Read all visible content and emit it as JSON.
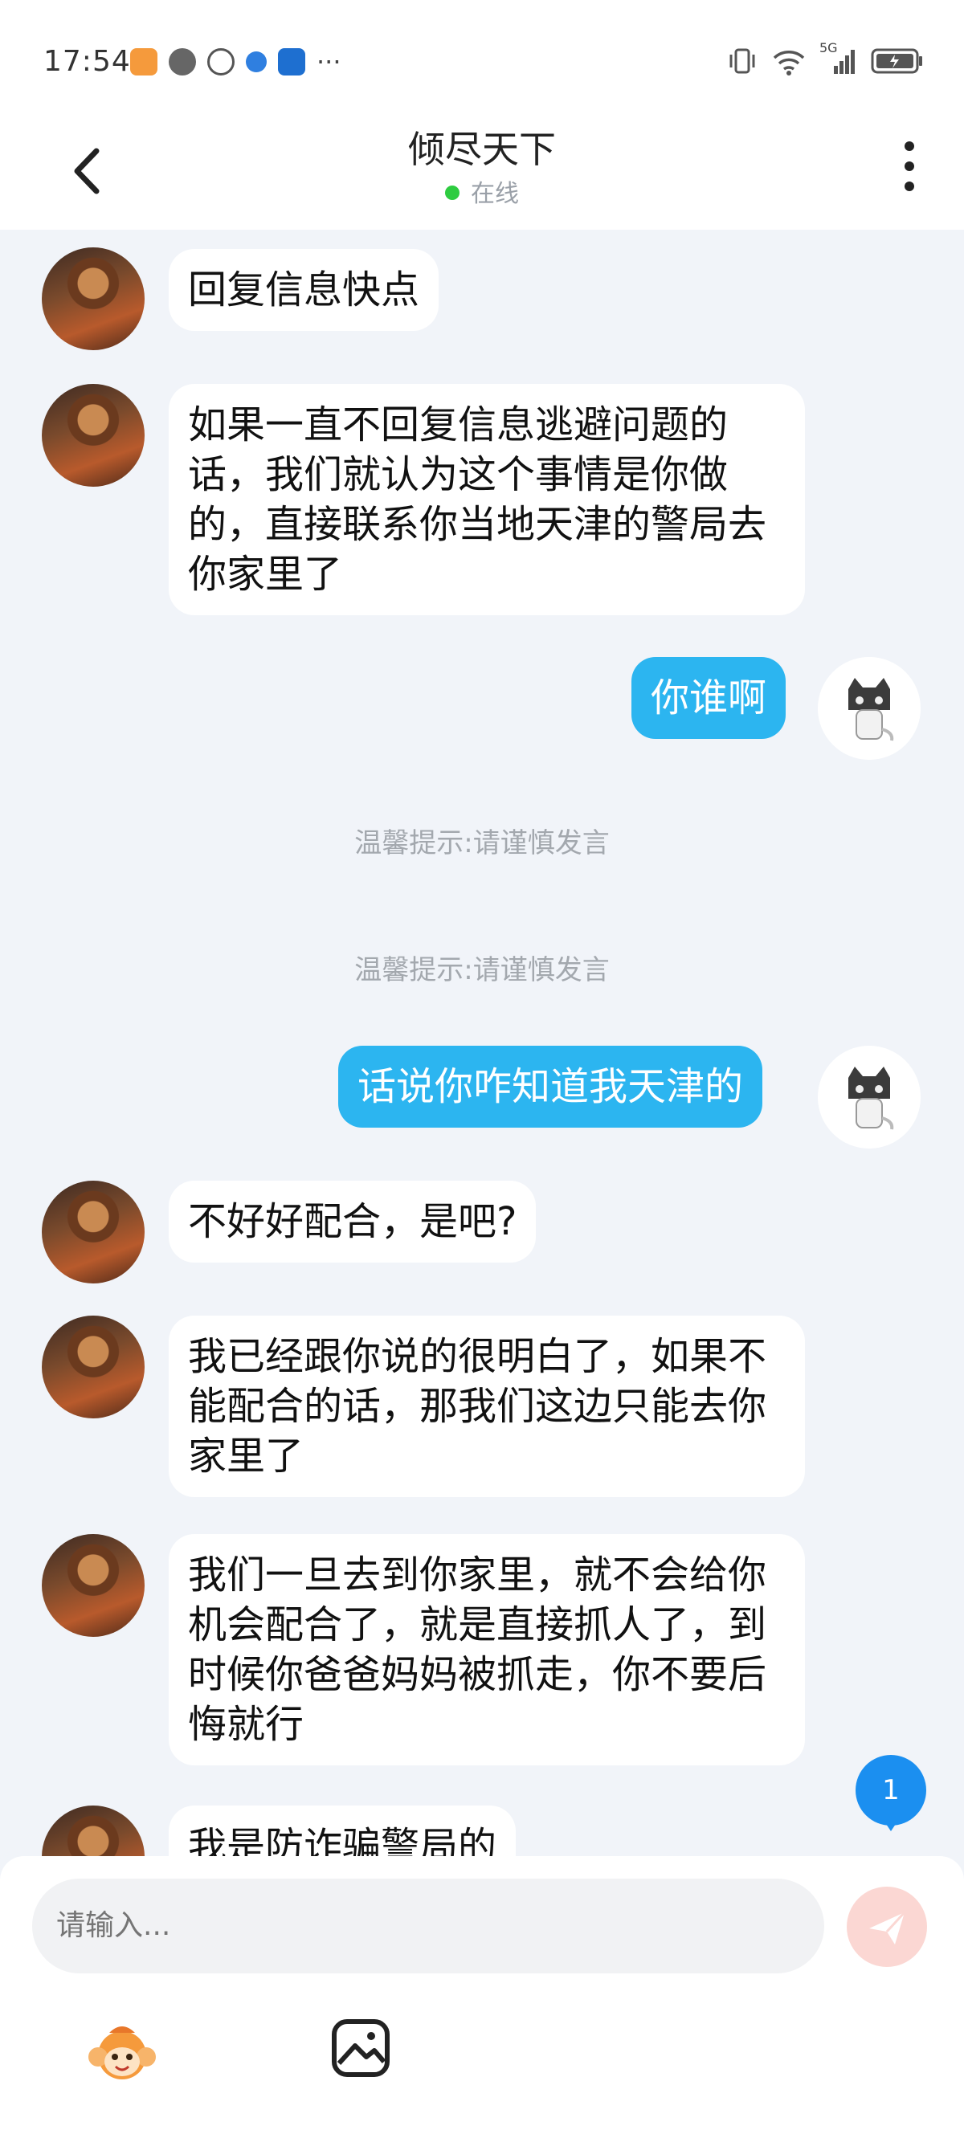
{
  "status_bar": {
    "time": "17:54",
    "more": "···",
    "network": "5G"
  },
  "header": {
    "title": "倾尽天下",
    "status": "在线"
  },
  "messages": [
    {
      "from": "other",
      "text": "回复信息快点"
    },
    {
      "from": "other",
      "text": "如果一直不回复信息逃避问题的话，我们就认为这个事情是你做的，直接联系你当地天津的警局去你家里了"
    },
    {
      "from": "self",
      "text": "你谁啊"
    },
    {
      "from": "system",
      "text": "温馨提示:请谨慎发言"
    },
    {
      "from": "system",
      "text": "温馨提示:请谨慎发言"
    },
    {
      "from": "self",
      "text": "话说你咋知道我天津的"
    },
    {
      "from": "other",
      "text": "不好好配合，是吧?"
    },
    {
      "from": "other",
      "text": "我已经跟你说的很明白了，如果不能配合的话，那我们这边只能去你家里了"
    },
    {
      "from": "other",
      "text": "我们一旦去到你家里，就不会给你机会配合了，就是直接抓人了，到时候你爸爸妈妈被抓走，你不要后悔就行"
    },
    {
      "from": "other",
      "text": "我是防诈骗警局的"
    }
  ],
  "unread_badge": "1",
  "input": {
    "placeholder": "请输入..."
  },
  "icons": {
    "back": "chevron-left-icon",
    "more": "more-vertical-icon",
    "send": "send-icon",
    "emoji": "monkey-emoji-icon",
    "image": "image-icon"
  },
  "colors": {
    "self_bubble": "#2cb5f0",
    "background": "#f1f4f9",
    "online": "#2ecc40",
    "badge": "#1b8ff0"
  }
}
